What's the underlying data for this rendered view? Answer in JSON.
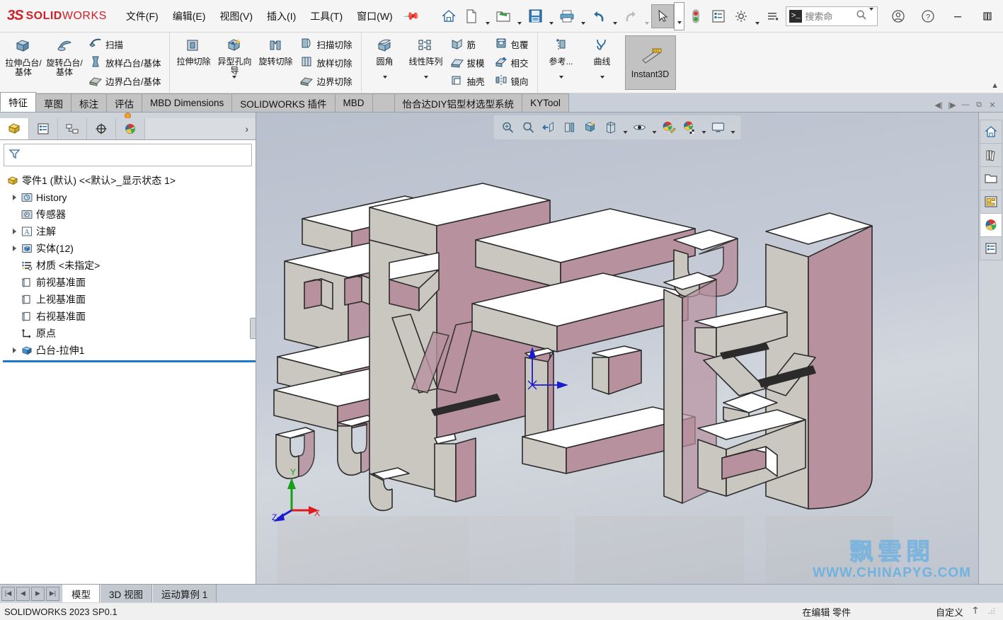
{
  "app": {
    "brand_ds": "3S",
    "brand_solid": "SOLID",
    "brand_works": "WORKS",
    "accent_red": "#d12027",
    "accent_blue": "#1e78c8"
  },
  "menu": {
    "items": [
      {
        "label": "文件(F)",
        "name": "menu-file"
      },
      {
        "label": "编辑(E)",
        "name": "menu-edit"
      },
      {
        "label": "视图(V)",
        "name": "menu-view"
      },
      {
        "label": "插入(I)",
        "name": "menu-insert"
      },
      {
        "label": "工具(T)",
        "name": "menu-tools"
      },
      {
        "label": "窗口(W)",
        "name": "menu-window"
      }
    ],
    "pin": "pin-icon"
  },
  "quick_toolbar": {
    "items": [
      {
        "name": "home-icon",
        "caret": false
      },
      {
        "name": "new-document-icon",
        "caret": true
      },
      {
        "name": "open-folder-icon",
        "caret": true
      },
      {
        "name": "save-icon",
        "caret": true
      },
      {
        "name": "print-icon",
        "caret": true
      },
      {
        "name": "undo-icon",
        "caret": true
      },
      {
        "name": "redo-icon",
        "caret": true,
        "disabled": true
      },
      {
        "name": "select-arrow-icon",
        "caret": true,
        "active": true
      },
      {
        "name": "rebuild-traffic-light-icon",
        "caret": false
      },
      {
        "name": "options-list-icon",
        "caret": false
      },
      {
        "name": "gear-settings-icon",
        "caret": true
      },
      {
        "name": "customize-icon",
        "caret": false
      }
    ]
  },
  "search": {
    "value": "搜索命",
    "placeholder": "搜索命令",
    "prompt_glyph": ">_",
    "magnifier": "search-icon",
    "caret": "chevron-down-icon"
  },
  "window_controls": {
    "account": "user-account-icon",
    "help": "help-icon",
    "minimize": "minimize-icon",
    "restore": "restore-icon",
    "maximize": "maximize-icon",
    "close": "close-icon"
  },
  "ribbon": {
    "groups": [
      {
        "name": "features-boss",
        "big": [
          {
            "label": "拉伸凸台/基体",
            "icon": "extrude-boss-icon"
          },
          {
            "label": "旋转凸台/基体",
            "icon": "revolve-boss-icon"
          }
        ],
        "small": [
          {
            "label": "扫描",
            "icon": "sweep-icon"
          },
          {
            "label": "放样凸台/基体",
            "icon": "loft-boss-icon"
          },
          {
            "label": "边界凸台/基体",
            "icon": "boundary-boss-icon"
          }
        ]
      },
      {
        "name": "features-cut",
        "big": [
          {
            "label": "拉伸切除",
            "icon": "extrude-cut-icon",
            "caret": false
          },
          {
            "label": "异型孔向导",
            "icon": "hole-wizard-icon",
            "caret": true
          },
          {
            "label": "旋转切除",
            "icon": "revolve-cut-icon",
            "caret": false
          }
        ],
        "small": [
          {
            "label": "扫描切除",
            "icon": "sweep-cut-icon"
          },
          {
            "label": "放样切除",
            "icon": "loft-cut-icon"
          },
          {
            "label": "边界切除",
            "icon": "boundary-cut-icon"
          }
        ]
      },
      {
        "name": "features-modify",
        "big": [
          {
            "label": "圆角",
            "icon": "fillet-icon",
            "caret": true
          },
          {
            "label": "线性阵列",
            "icon": "linear-pattern-icon",
            "caret": true
          }
        ],
        "small": [
          {
            "label": "筋",
            "icon": "rib-icon"
          },
          {
            "label": "拔模",
            "icon": "draft-icon"
          },
          {
            "label": "抽壳",
            "icon": "shell-icon"
          }
        ],
        "small2": [
          {
            "label": "包覆",
            "icon": "wrap-icon"
          },
          {
            "label": "相交",
            "icon": "intersect-icon"
          },
          {
            "label": "镜向",
            "icon": "mirror-icon"
          }
        ]
      },
      {
        "name": "features-reference",
        "big": [
          {
            "label": "参考...",
            "icon": "reference-geometry-icon",
            "caret": true
          },
          {
            "label": "曲线",
            "icon": "curves-icon",
            "caret": true
          }
        ],
        "toggle": {
          "label": "Instant3D",
          "icon": "instant3d-icon",
          "active": true
        }
      }
    ]
  },
  "command_tabs": {
    "items": [
      {
        "label": "特征",
        "active": true
      },
      {
        "label": "草图",
        "active": false
      },
      {
        "label": "标注",
        "active": false
      },
      {
        "label": "评估",
        "active": false
      },
      {
        "label": "MBD Dimensions",
        "active": false
      },
      {
        "label": "SOLIDWORKS 插件",
        "active": false
      },
      {
        "label": "MBD",
        "active": false
      },
      {
        "label": "",
        "active": false
      },
      {
        "label": "怡合达DIY铝型材选型系统",
        "active": false
      },
      {
        "label": "KYTool",
        "active": false
      }
    ]
  },
  "feature_manager": {
    "tabs": [
      {
        "name": "feature-tree-tab",
        "icon": "feature-tree-icon",
        "active": true
      },
      {
        "name": "property-manager-tab",
        "icon": "property-manager-icon",
        "active": false
      },
      {
        "name": "configuration-manager-tab",
        "icon": "configuration-manager-icon",
        "active": false
      },
      {
        "name": "dimxpert-manager-tab",
        "icon": "dimxpert-icon",
        "active": false
      },
      {
        "name": "display-manager-tab",
        "icon": "display-manager-icon",
        "active": false
      }
    ],
    "expand_arrow": "chevron-right-icon",
    "filter_placeholder": "",
    "filter_icon": "filter-icon",
    "tree": [
      {
        "label": "零件1 (默认) <<默认>_显示状态 1>",
        "icon": "part-icon",
        "expand": false,
        "indent": 0
      },
      {
        "label": "History",
        "icon": "history-icon",
        "expand": true,
        "indent": 1
      },
      {
        "label": "传感器",
        "icon": "sensors-icon",
        "expand": false,
        "indent": 1
      },
      {
        "label": "注解",
        "icon": "annotations-icon",
        "expand": true,
        "indent": 1
      },
      {
        "label": "实体(12)",
        "icon": "solid-bodies-icon",
        "expand": true,
        "indent": 1
      },
      {
        "label": "材质 <未指定>",
        "icon": "material-icon",
        "expand": false,
        "indent": 1
      },
      {
        "label": "前视基准面",
        "icon": "plane-icon",
        "expand": false,
        "indent": 1
      },
      {
        "label": "上视基准面",
        "icon": "plane-icon",
        "expand": false,
        "indent": 1
      },
      {
        "label": "右视基准面",
        "icon": "plane-icon",
        "expand": false,
        "indent": 1
      },
      {
        "label": "原点",
        "icon": "origin-icon",
        "expand": false,
        "indent": 1
      },
      {
        "label": "凸台-拉伸1",
        "icon": "extrude-feature-icon",
        "expand": true,
        "indent": 1
      }
    ]
  },
  "heads_up_view": {
    "items": [
      {
        "name": "zoom-to-fit-icon",
        "caret": false
      },
      {
        "name": "zoom-to-area-icon",
        "caret": false
      },
      {
        "name": "previous-view-icon",
        "caret": false
      },
      {
        "name": "section-view-icon",
        "caret": false
      },
      {
        "name": "view-orientation-icon",
        "caret": false
      },
      {
        "name": "display-style-icon",
        "caret": true
      },
      {
        "name": "hide-show-items-icon",
        "caret": true
      },
      {
        "name": "edit-appearance-icon",
        "caret": false
      },
      {
        "name": "apply-scene-icon",
        "caret": true
      },
      {
        "name": "view-settings-icon",
        "caret": true
      }
    ]
  },
  "task_pane": {
    "items": [
      {
        "name": "task-home-icon",
        "active": false
      },
      {
        "name": "design-library-icon",
        "active": false
      },
      {
        "name": "file-explorer-icon",
        "active": false
      },
      {
        "name": "view-palette-icon",
        "active": false
      },
      {
        "name": "appearances-scenes-icon",
        "active": true
      },
      {
        "name": "custom-properties-icon",
        "active": false
      }
    ]
  },
  "graphics": {
    "triad": {
      "x_label": "X",
      "y_label": "Y",
      "z_label": "Z",
      "x_color": "#e01b1b",
      "y_color": "#15a015",
      "z_color": "#1a1ad0"
    },
    "origin_marker": "origin-triad-marker",
    "model_description": "飘風云阁 extruded text solid",
    "model_top_color": "#ffffff",
    "model_face_color": "#c9c6bf",
    "model_side_color": "#b8919f"
  },
  "watermark": {
    "line1": "飘雲閣",
    "line2": "WWW.CHINAPYG.COM",
    "color": "#76b4e0"
  },
  "bottom_tabs": {
    "nav": [
      "first-icon",
      "prev-icon",
      "next-icon",
      "last-icon"
    ],
    "items": [
      {
        "label": "模型",
        "active": true
      },
      {
        "label": "3D 视图",
        "active": false
      },
      {
        "label": "运动算例 1",
        "active": false
      }
    ]
  },
  "status_bar": {
    "left": "SOLIDWORKS 2023 SP0.1",
    "middle": "在编辑 零件",
    "right": "自定义",
    "units_icon": "units-icon",
    "grip_icon": "resize-grip-icon"
  }
}
